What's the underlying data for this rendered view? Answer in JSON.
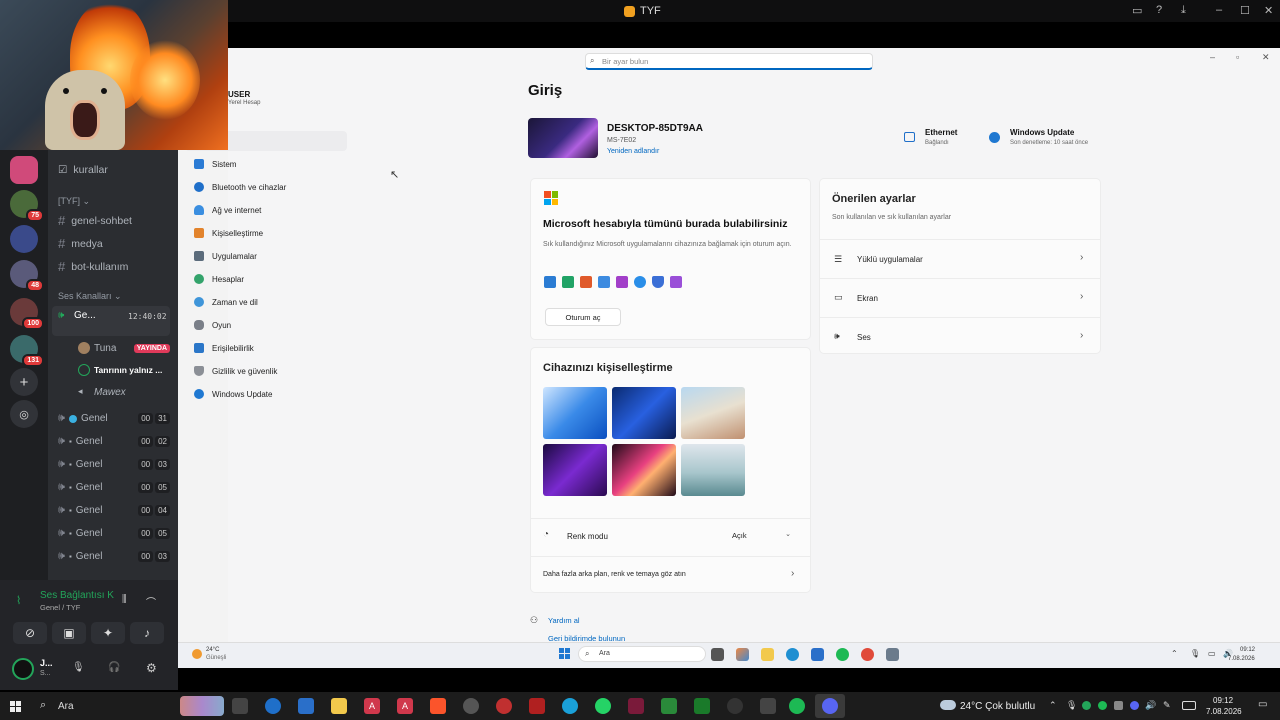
{
  "topbar": {
    "title": "TYF"
  },
  "discord": {
    "channels": [
      {
        "name": "kurallar"
      },
      {
        "name": "genel-sohbet"
      },
      {
        "name": "medya"
      },
      {
        "name": "bot-kullanım"
      }
    ],
    "category": "[TYF]",
    "voice_category": "Ses Kanalları",
    "active_voice": {
      "name": "Ge...",
      "time": "12:40:02"
    },
    "voice_users": [
      {
        "name": "Tuna",
        "badge": "YAYINDA"
      },
      {
        "name": "Tanrının yalnız ..."
      },
      {
        "name": "Mawex"
      }
    ],
    "voice_channels": [
      {
        "name": "Genel",
        "a": "00",
        "b": "31"
      },
      {
        "name": "Genel",
        "a": "00",
        "b": "02"
      },
      {
        "name": "Genel",
        "a": "00",
        "b": "03"
      },
      {
        "name": "Genel",
        "a": "00",
        "b": "05"
      },
      {
        "name": "Genel",
        "a": "00",
        "b": "04"
      },
      {
        "name": "Genel",
        "a": "00",
        "b": "05"
      },
      {
        "name": "Genel",
        "a": "00",
        "b": "03"
      }
    ],
    "server_badges": [
      "75",
      "48",
      "100",
      "131"
    ],
    "voice_panel": {
      "status": "Ses Bağlantısı K",
      "channel": "Genel / TYF",
      "user": "J...",
      "user_sub": "S..."
    }
  },
  "settings": {
    "search_placeholder": "Bir ayar bulun",
    "user": {
      "name": "USER",
      "type": "Yerel Hesap"
    },
    "nav": [
      "Sistem",
      "Bluetooth ve cihazlar",
      "Ağ ve internet",
      "Kişiselleştirme",
      "Uygulamalar",
      "Hesaplar",
      "Zaman ve dil",
      "Oyun",
      "Erişilebilirlik",
      "Gizlilik ve güvenlik",
      "Windows Update"
    ],
    "page_title": "Giriş",
    "device": {
      "name": "DESKTOP-85DT9AA",
      "model": "MS-7E02",
      "rename": "Yeniden adlandır"
    },
    "ethernet": {
      "title": "Ethernet",
      "status": "Bağlandı"
    },
    "winupdate": {
      "title": "Windows Update",
      "status": "Son denetleme: 10 saat önce"
    },
    "ms_card": {
      "title": "Microsoft hesabıyla tümünü burada bulabilirsiniz",
      "desc": "Sık kullandığınız Microsoft uygulamalarını cihazınıza bağlamak için oturum açın.",
      "button": "Oturum aç"
    },
    "recommended": {
      "title": "Önerilen ayarlar",
      "desc": "Son kullanılan ve sık kullanılan ayarlar",
      "items": [
        "Yüklü uygulamalar",
        "Ekran",
        "Ses"
      ]
    },
    "personalize": {
      "title": "Cihazınızı kişiselleştirme",
      "color_mode_label": "Renk modu",
      "color_mode_value": "Açık",
      "more": "Daha fazla arka plan, renk ve temaya göz atın"
    },
    "help": "Yardım al",
    "feedback": "Geri bildirimde bulunun"
  },
  "inner_taskbar": {
    "weather_temp": "24°C",
    "weather_text": "Güneşli",
    "search": "Ara",
    "time": "09:12",
    "date": "7.08.2026"
  },
  "host_taskbar": {
    "search": "Ara",
    "weather": "24°C  Çok bulutlu",
    "time": "09:12",
    "date": "7.08.2026"
  },
  "colors": {
    "accent": "#0067c0",
    "discord_bg": "#2b2d31",
    "live_badge": "#e03a5a"
  }
}
